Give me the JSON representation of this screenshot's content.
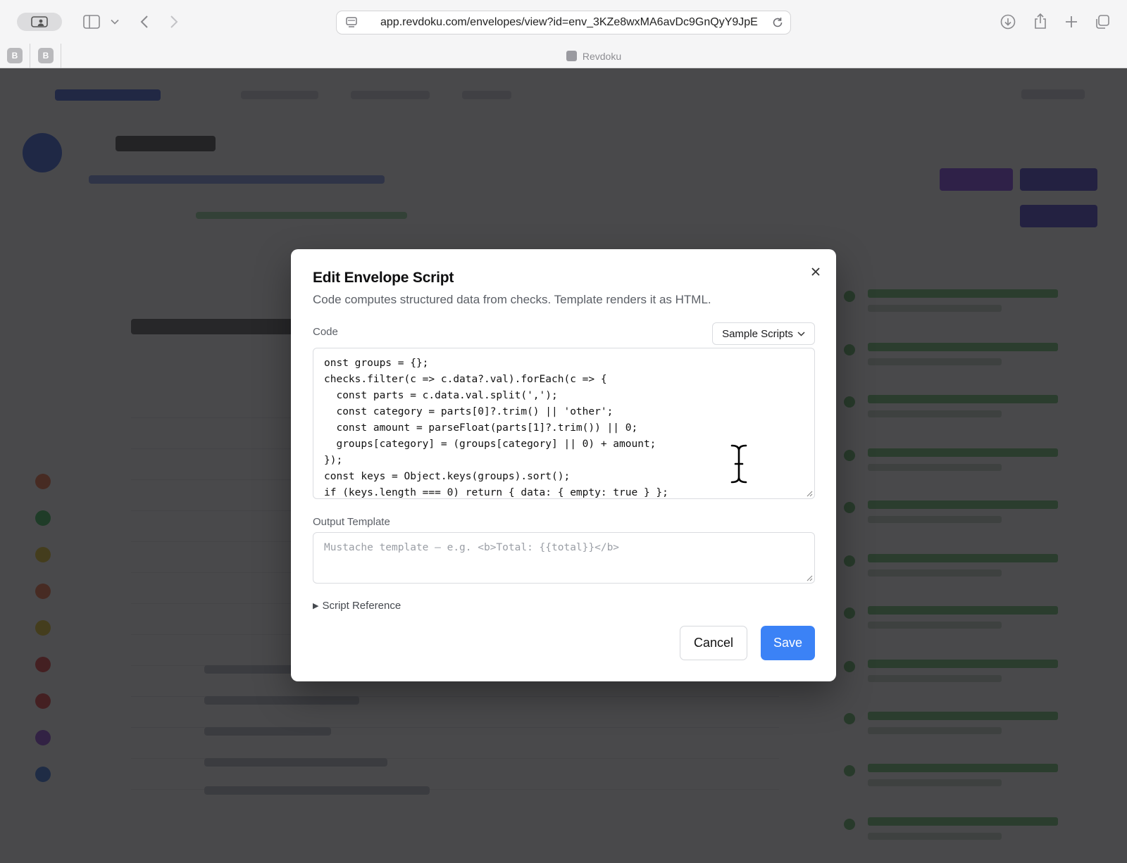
{
  "browser": {
    "url": "app.revdoku.com/envelopes/view?id=env_3KZe8wxMA6avDc9GnQyY9JpE",
    "tab_title": "Revdoku",
    "pinned_tabs": [
      "B",
      "B"
    ]
  },
  "modal": {
    "title": "Edit Envelope Script",
    "description": "Code computes structured data from checks. Template renders it as HTML.",
    "code_label": "Code",
    "sample_scripts_label": "Sample Scripts",
    "code_lines": [
      "onst groups = {};",
      "checks.filter(c => c.data?.val).forEach(c => {",
      "  const parts = c.data.val.split(',');",
      "  const category = parts[0]?.trim() || 'other';",
      "  const amount = parseFloat(parts[1]?.trim()) || 0;",
      "  groups[category] = (groups[category] || 0) + amount;",
      "});",
      "const keys = Object.keys(groups).sort();",
      "if (keys.length === 0) return { data: { empty: true } };"
    ],
    "template_label": "Output Template",
    "template_placeholder": "Mustache template — e.g. <b>Total: {{total}}</b>",
    "script_reference_label": "Script Reference",
    "cancel_label": "Cancel",
    "save_label": "Save"
  },
  "colors": {
    "accent": "#3b82f6",
    "overlay": "#1c1c1e"
  }
}
